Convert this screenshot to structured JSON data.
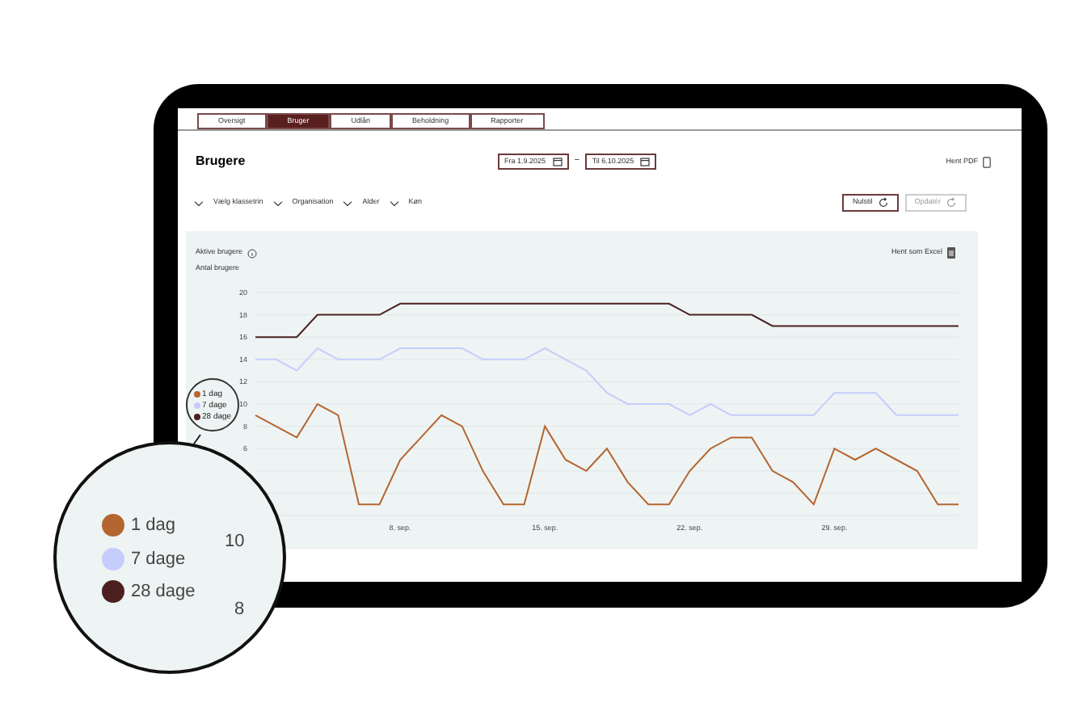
{
  "tabs": [
    {
      "label": "Oversigt",
      "selected": false
    },
    {
      "label": "Bruger",
      "selected": true
    },
    {
      "label": "Udlån",
      "selected": false
    },
    {
      "label": "Beholdning",
      "selected": false
    },
    {
      "label": "Rapporter",
      "selected": false
    }
  ],
  "title": "Brugere",
  "date_from": {
    "value": "Fra 1.9.2025"
  },
  "date_separator": "–",
  "date_to": {
    "value": "Til 6.10.2025"
  },
  "pdf_link": "Hent PDF",
  "filters": [
    "Vælg klassetrin",
    "Organisation",
    "Alder",
    "Køn"
  ],
  "buttons": [
    {
      "label": "Nulstil",
      "disabled": false
    },
    {
      "label": "Opdatér",
      "disabled": true
    }
  ],
  "panel": {
    "title": "Aktive brugere",
    "excel_link": "Hent som Excel",
    "chart_data": {
      "type": "line",
      "grid": true,
      "categories": [
        null,
        null,
        null,
        null,
        null,
        null,
        null,
        "8. sep.",
        null,
        null,
        null,
        null,
        null,
        null,
        "15. sep.",
        null,
        null,
        null,
        null,
        null,
        null,
        "22. sep.",
        null,
        null,
        null,
        null,
        null,
        null,
        "29. sep.",
        null,
        null,
        null,
        null,
        null,
        null
      ],
      "ylabel": "Antal brugere",
      "ylim": [
        0,
        20
      ],
      "yticks": [
        6,
        8,
        10,
        12,
        14,
        16,
        18,
        20
      ],
      "series": [
        {
          "name": "1 dag",
          "color": "#b5652f",
          "values": [
            9,
            8,
            7,
            10,
            9,
            1,
            1,
            5,
            7,
            9,
            8,
            4,
            1,
            1,
            8,
            5,
            4,
            6,
            3,
            1,
            1,
            4,
            6,
            7,
            7,
            4,
            3,
            1,
            6,
            5,
            6,
            5,
            4,
            1,
            1
          ]
        },
        {
          "name": "7 dage",
          "color": "#c5cdfc",
          "values": [
            14,
            14,
            13,
            15,
            14,
            14,
            14,
            15,
            15,
            15,
            15,
            14,
            14,
            14,
            15,
            14,
            13,
            11,
            10,
            10,
            10,
            9,
            10,
            9,
            9,
            9,
            9,
            9,
            11,
            11,
            11,
            9,
            9,
            9,
            9
          ]
        },
        {
          "name": "28 dage",
          "color": "#4d2020",
          "values": [
            16,
            16,
            16,
            18,
            18,
            18,
            18,
            19,
            19,
            19,
            19,
            19,
            19,
            19,
            19,
            19,
            19,
            19,
            19,
            19,
            19,
            18,
            18,
            18,
            18,
            17,
            17,
            17,
            17,
            17,
            17,
            17,
            17,
            17,
            17
          ]
        }
      ]
    }
  },
  "magnifier": {
    "legend": [
      {
        "label": "1 dag",
        "color": "#b5652f"
      },
      {
        "label": "7 dage",
        "color": "#c5cdfc"
      },
      {
        "label": "28 dage",
        "color": "#4d2020"
      }
    ],
    "labels": [
      "10",
      "8"
    ]
  }
}
